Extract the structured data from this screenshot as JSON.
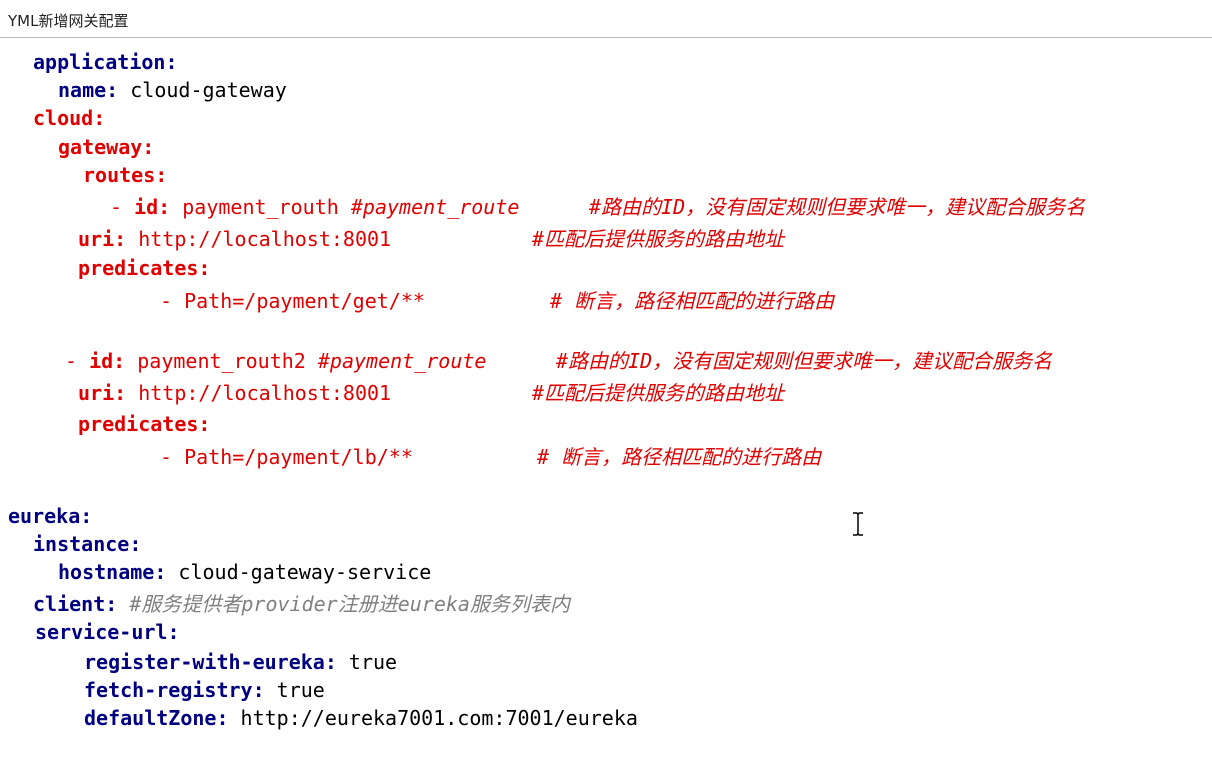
{
  "window": {
    "title": "YML新增网关配置"
  },
  "colors": {
    "key_blue": "#000080",
    "key_red": "#e00000",
    "comment_red": "#e00000",
    "comment_gray": "#808080"
  },
  "code": {
    "application_key": "application:",
    "name_key": "name:",
    "name_value": "cloud-gateway",
    "cloud_key": "cloud:",
    "gateway_key": "gateway:",
    "routes_key": "routes:",
    "route1": {
      "dash": "- ",
      "id_key": "id:",
      "id_value": "payment_routh",
      "id_inline": "#payment_route",
      "id_comment": "#路由的ID，没有固定规则但要求唯一，建议配合服务名",
      "uri_key": "uri:",
      "uri_value": "http://localhost:8001",
      "uri_comment": "#匹配后提供服务的路由地址",
      "predicates_key": "predicates:",
      "path_value": "- Path=/payment/get/**",
      "path_comment": "# 断言，路径相匹配的进行路由"
    },
    "route2": {
      "dash": "- ",
      "id_key": "id:",
      "id_value": "payment_routh2",
      "id_inline": "#payment_route",
      "id_comment": "#路由的ID，没有固定规则但要求唯一，建议配合服务名",
      "uri_key": "uri:",
      "uri_value": "http://localhost:8001",
      "uri_comment": "#匹配后提供服务的路由地址",
      "predicates_key": "predicates:",
      "path_value": "- Path=/payment/lb/**",
      "path_comment": "# 断言，路径相匹配的进行路由"
    },
    "eureka_key": "eureka:",
    "instance_key": "instance:",
    "hostname_key": "hostname:",
    "hostname_value": "cloud-gateway-service",
    "client_key": "client:",
    "client_comment": "#服务提供者provider注册进eureka服务列表内",
    "service_url_key": "service-url:",
    "register_key": "register-with-eureka:",
    "register_value": "true",
    "fetch_key": "fetch-registry:",
    "fetch_value": "true",
    "defaultzone_key": "defaultZone:",
    "defaultzone_value": "http://eureka7001.com:7001/eureka"
  },
  "icons": {
    "cursor": "text-cursor-icon"
  }
}
